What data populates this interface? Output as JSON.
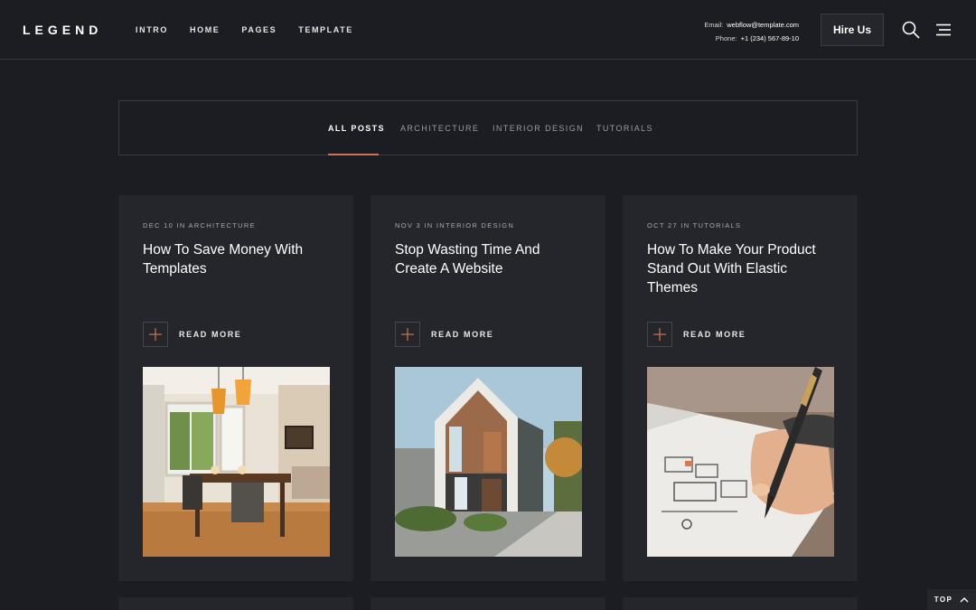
{
  "brand": {
    "logo": "LEGEND"
  },
  "nav": [
    {
      "label": "INTRO"
    },
    {
      "label": "HOME"
    },
    {
      "label": "PAGES"
    },
    {
      "label": "TEMPLATE"
    }
  ],
  "contact": {
    "email_label": "Email:",
    "email": "webflow@template.com",
    "phone_label": "Phone:",
    "phone": "+1 (234) 567-89-10"
  },
  "header": {
    "hire_label": "Hire Us"
  },
  "filters": [
    {
      "label": "ALL POSTS",
      "active": true
    },
    {
      "label": "ARCHITECTURE",
      "active": false
    },
    {
      "label": "INTERIOR DESIGN",
      "active": false
    },
    {
      "label": "TUTORIALS",
      "active": false
    }
  ],
  "posts": [
    {
      "meta": "DEC 10 IN ARCHITECTURE",
      "title": "How To Save Money With Templates",
      "cta": "READ MORE"
    },
    {
      "meta": "NOV 3 IN INTERIOR DESIGN",
      "title": "Stop Wasting Time And Create A Website",
      "cta": "READ MORE"
    },
    {
      "meta": "OCT 27 IN TUTORIALS",
      "title": "How To Make Your Product Stand Out With Elastic Themes",
      "cta": "READ MORE"
    }
  ],
  "scroll_top": {
    "label": "TOP"
  },
  "colors": {
    "background": "#1c1d22",
    "card": "#25262c",
    "accent": "#c9764f",
    "text": "#ffffff",
    "muted": "#9a9ba0"
  },
  "icons": [
    "search-icon",
    "menu-icon",
    "plus-icon",
    "chevron-up-icon"
  ]
}
